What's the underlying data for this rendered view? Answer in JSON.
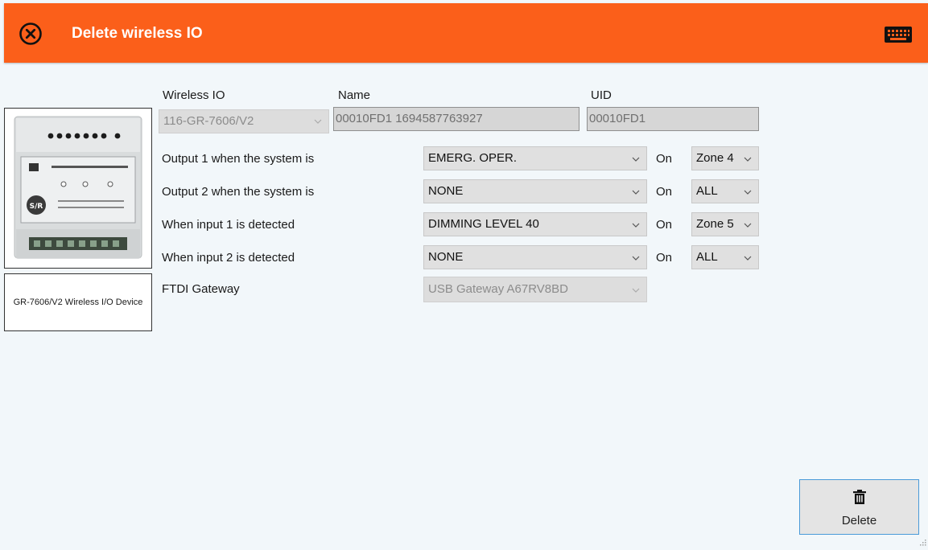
{
  "header": {
    "title": "Delete wireless IO",
    "close_icon": "close-circle-icon",
    "keyboard_icon": "keyboard-icon",
    "bg_color": "#fb5f1a"
  },
  "device": {
    "caption": "GR-7606/V2 Wireless I/O Device"
  },
  "fields": {
    "wireless_io_label": "Wireless IO",
    "wireless_io_value": "116-GR-7606/V2",
    "name_label": "Name",
    "name_value": "00010FD1 1694587763927",
    "uid_label": "UID",
    "uid_value": "00010FD1"
  },
  "rows": [
    {
      "label": "Output 1 when the system is",
      "value": "EMERG. OPER.",
      "on_label": "On",
      "zone": "Zone 4"
    },
    {
      "label": "Output 2 when the system is",
      "value": "NONE",
      "on_label": "On",
      "zone": "ALL"
    },
    {
      "label": "When input 1 is detected",
      "value": "DIMMING LEVEL 40",
      "on_label": "On",
      "zone": "Zone 5"
    },
    {
      "label": "When input 2 is detected",
      "value": "NONE",
      "on_label": "On",
      "zone": "ALL"
    }
  ],
  "gateway": {
    "label": "FTDI Gateway",
    "value": "USB Gateway A67RV8BD"
  },
  "actions": {
    "delete_label": "Delete",
    "delete_icon": "trash-icon",
    "accent_color": "#4a9ad8"
  }
}
